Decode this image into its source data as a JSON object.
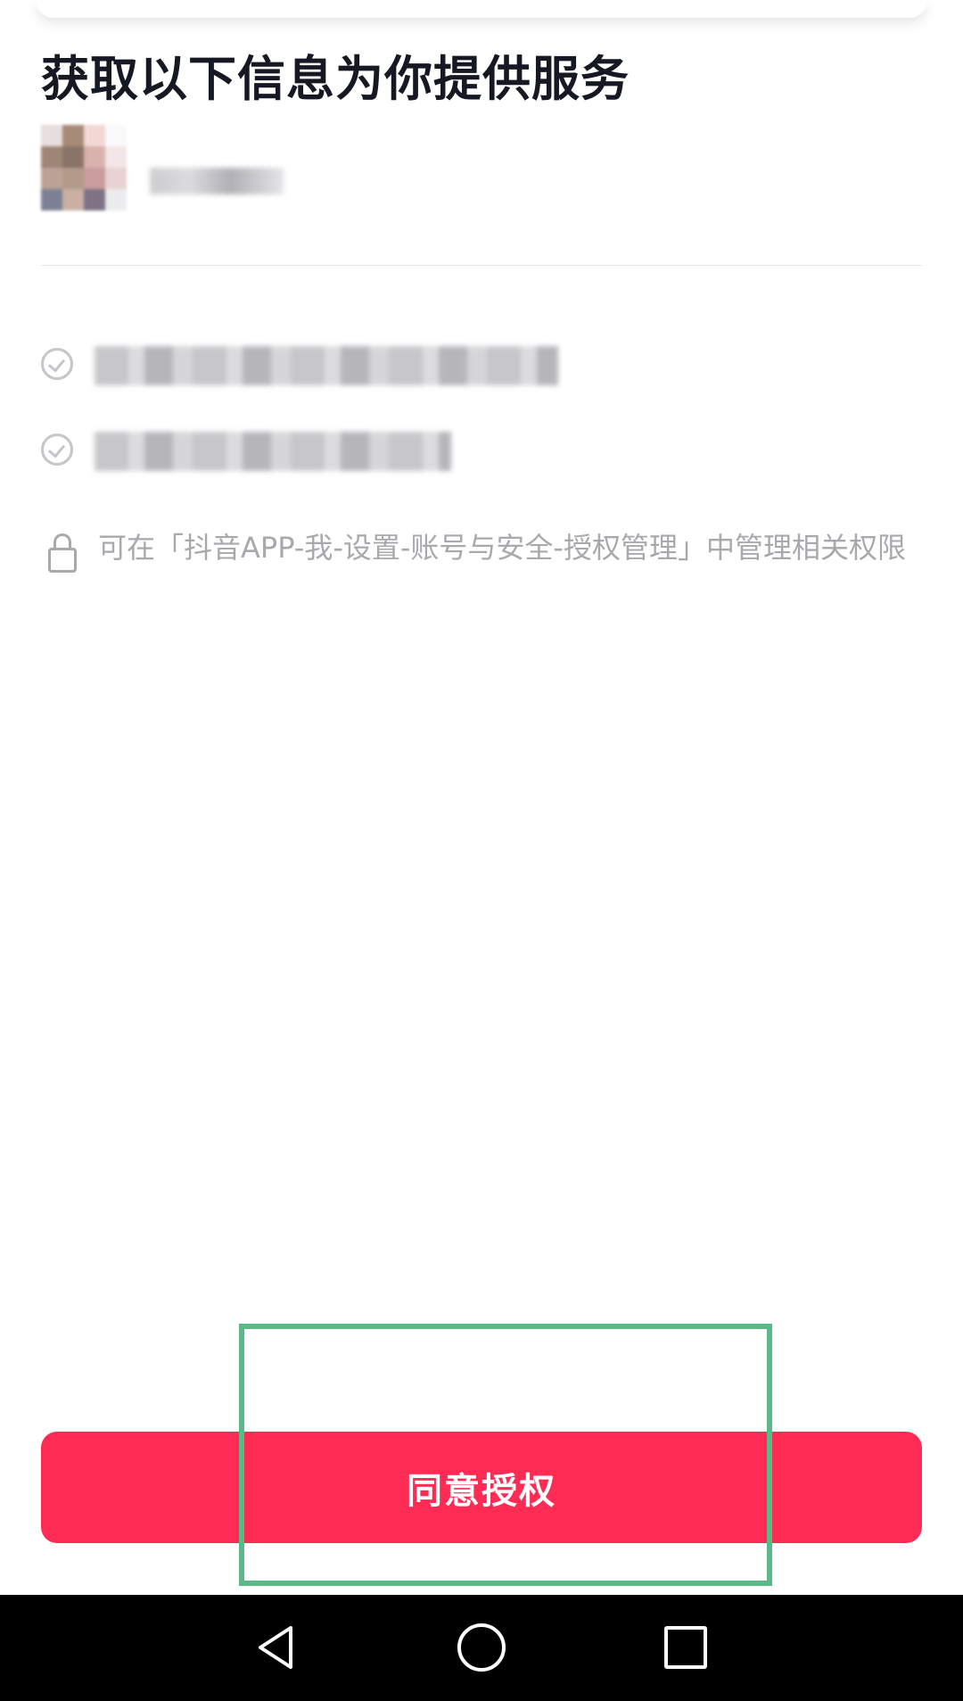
{
  "header": {
    "title": "获取以下信息为你提供服务"
  },
  "profile": {
    "avatar_icon": "avatar-icon",
    "nickname_hidden": true
  },
  "permissions": [
    {
      "icon": "check-circle-icon",
      "label_hidden": true
    },
    {
      "icon": "check-circle-icon",
      "label_hidden": true
    }
  ],
  "note": {
    "icon": "lock-icon",
    "text": "可在「抖音APP-我-设置-账号与安全-授权管理」中管理相关权限"
  },
  "actions": {
    "agree_label": "同意授权"
  },
  "colors": {
    "accent": "#fe2c55",
    "highlight": "#5db888",
    "title_text": "#161823",
    "muted_text": "#a8a9ac"
  },
  "navbar": {
    "back_icon": "back-triangle-icon",
    "home_icon": "home-circle-icon",
    "recent_icon": "recent-square-icon"
  }
}
